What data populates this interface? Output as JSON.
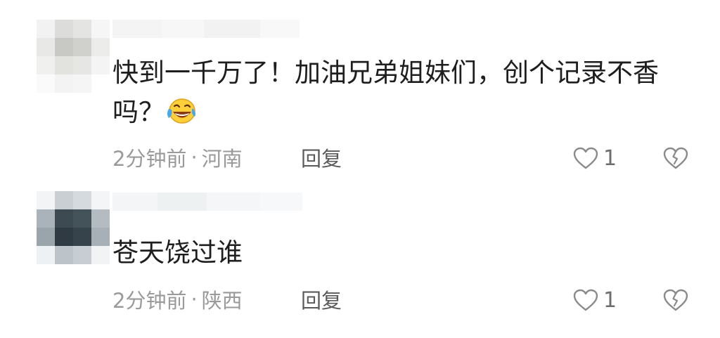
{
  "comments": [
    {
      "text": "快到一千万了！加油兄弟姐妹们，创个记录不香吗？",
      "emoji": "laughing-with-tears-emoji",
      "time": "2分钟前",
      "separator": "·",
      "location": "河南",
      "reply_label": "回复",
      "likes": "1"
    },
    {
      "text": "苍天饶过谁",
      "time": "2分钟前",
      "separator": "·",
      "location": "陕西",
      "reply_label": "回复",
      "likes": "1"
    }
  ],
  "icons": {
    "like": "heart-outline-icon",
    "dislike": "broken-heart-icon"
  },
  "colors": {
    "text": "#1e1e1e",
    "meta": "#9a9a9a",
    "reply": "#5a5a5a",
    "icon": "#8a8a8a"
  }
}
